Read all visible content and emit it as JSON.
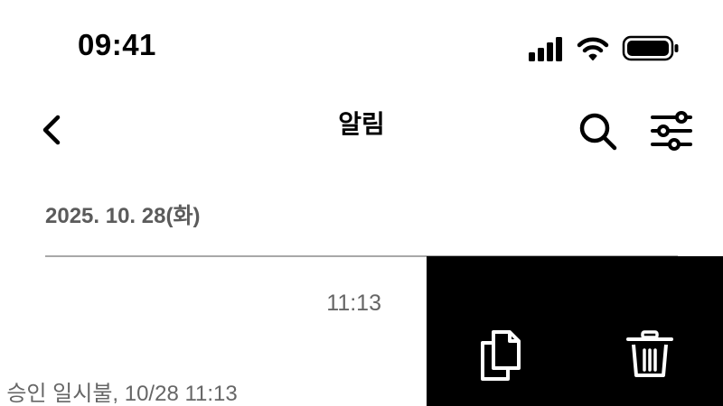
{
  "status_bar": {
    "time": "09:41",
    "icons": [
      "cellular-signal-icon",
      "wifi-icon",
      "battery-icon"
    ]
  },
  "nav": {
    "back_icon": "chevron-left-icon",
    "title": "알림",
    "actions": [
      "search-icon",
      "filter-sliders-icon"
    ]
  },
  "section": {
    "date": "2025. 10. 28(화)"
  },
  "notification": {
    "time": "11:13",
    "preview": ". 승인 일시불, 10/28 11:13",
    "actions": {
      "copy_icon": "copy-icon",
      "delete_icon": "trash-icon",
      "panel_color": "#000000"
    }
  },
  "colors": {
    "background": "#ffffff",
    "text_primary": "#000000",
    "text_secondary": "#666666",
    "section_header": "#5b5b5b",
    "divider": "#a8a8a8"
  }
}
